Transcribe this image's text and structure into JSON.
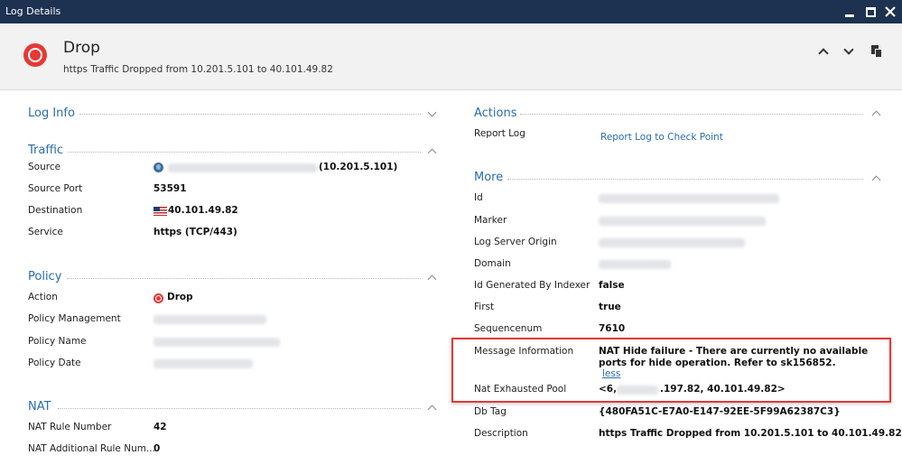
{
  "window": {
    "title": "Log Details"
  },
  "header": {
    "title": "Drop",
    "subtitle": "https Traffic Dropped from 10.201.5.101 to 40.101.49.82"
  },
  "sections": {
    "log_info": {
      "title": "Log Info"
    },
    "traffic": {
      "title": "Traffic",
      "source_label": "Source",
      "source_ip": "(10.201.5.101)",
      "source_port_label": "Source Port",
      "source_port": "53591",
      "destination_label": "Destination",
      "destination": "40.101.49.82",
      "service_label": "Service",
      "service": "https (TCP/443)"
    },
    "policy": {
      "title": "Policy",
      "action_label": "Action",
      "action": "Drop",
      "management_label": "Policy Management",
      "name_label": "Policy Name",
      "date_label": "Policy Date"
    },
    "nat": {
      "title": "NAT",
      "rule_number_label": "NAT Rule Number",
      "rule_number": "42",
      "additional_label": "NAT Additional Rule Num...",
      "additional": "0"
    },
    "actions": {
      "title": "Actions",
      "report_label": "Report Log",
      "report_link": "Report Log to Check Point"
    },
    "more": {
      "title": "More",
      "id_label": "Id",
      "marker_label": "Marker",
      "origin_label": "Log Server Origin",
      "domain_label": "Domain",
      "indexer_label": "Id Generated By Indexer",
      "indexer": "false",
      "first_label": "First",
      "first": "true",
      "seq_label": "Sequencenum",
      "seq": "7610",
      "msg_label": "Message Information",
      "msg": "NAT Hide failure - There are currently no available ports for hide operation. Refer to sk156852.",
      "less_link": "less",
      "pool_label": "Nat Exhausted Pool",
      "pool_prefix": "<6,",
      "pool_suffix": ".197.82, 40.101.49.82>",
      "dbtag_label": "Db Tag",
      "dbtag": "{480FA51C-E7A0-E147-92EE-5F99A62387C3}",
      "desc_label": "Description",
      "desc": "https Traffic Dropped from 10.201.5.101 to 40.101.49.82"
    }
  },
  "colors": {
    "titlebar": "#1d3150",
    "accent": "#2b6cb0",
    "drop_red": "#e53935",
    "highlight_box": "#e53935"
  }
}
